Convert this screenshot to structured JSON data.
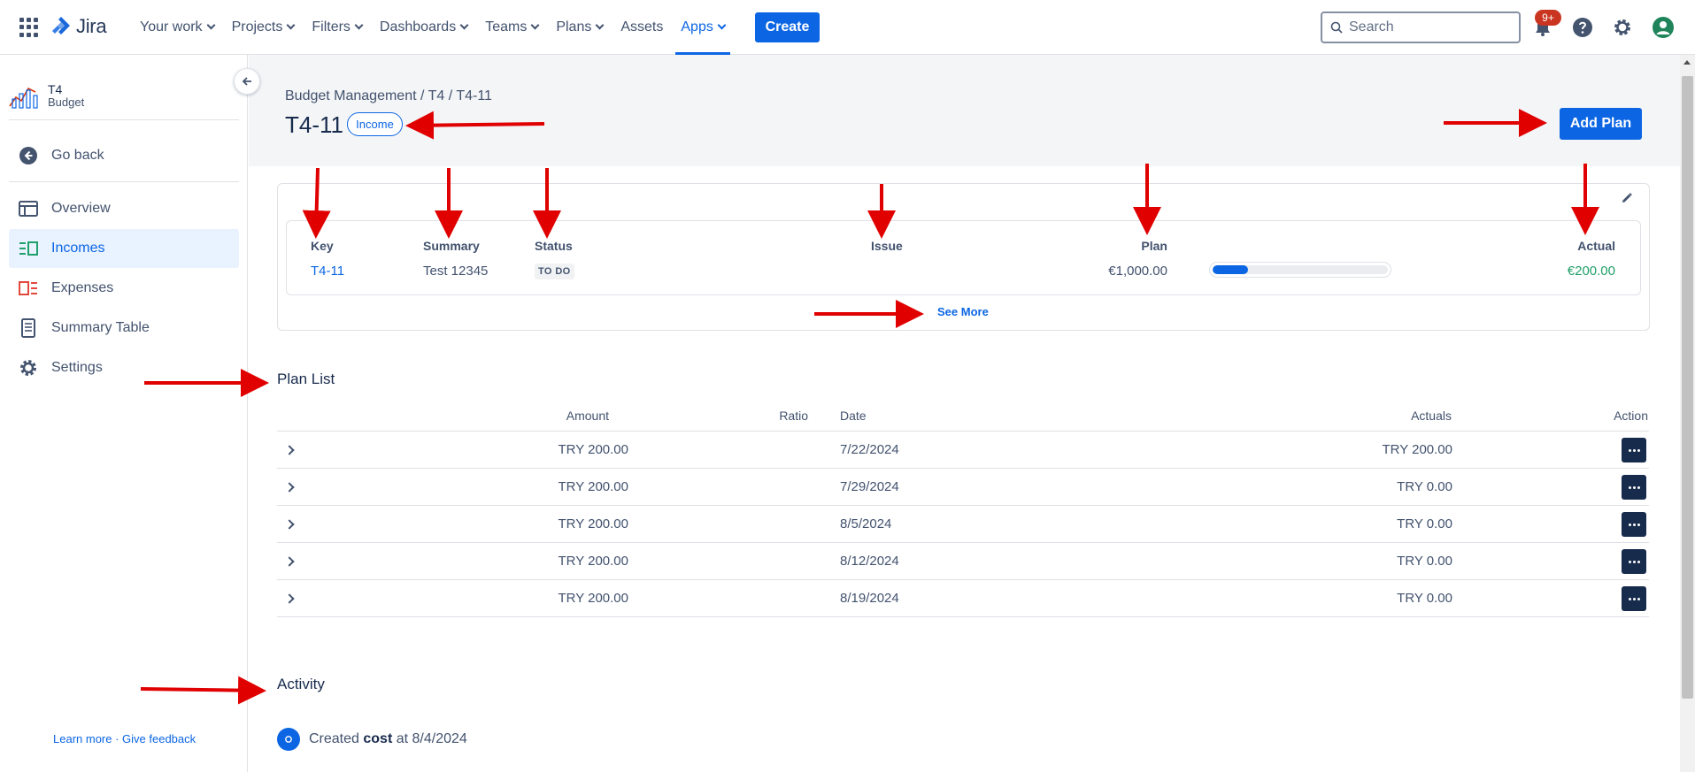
{
  "topnav": {
    "product": "Jira",
    "items": [
      {
        "label": "Your work",
        "dropdown": true
      },
      {
        "label": "Projects",
        "dropdown": true
      },
      {
        "label": "Filters",
        "dropdown": true
      },
      {
        "label": "Dashboards",
        "dropdown": true
      },
      {
        "label": "Teams",
        "dropdown": true
      },
      {
        "label": "Plans",
        "dropdown": true
      },
      {
        "label": "Assets",
        "dropdown": false
      },
      {
        "label": "Apps",
        "dropdown": true,
        "active": true
      }
    ],
    "create_label": "Create",
    "search_placeholder": "Search",
    "notification_badge": "9+"
  },
  "sidebar": {
    "project_name": "T4",
    "project_sub": "Budget",
    "items": [
      {
        "label": "Go back",
        "icon": "arrow-left-circle-icon"
      },
      {
        "label": "Overview",
        "icon": "overview-icon"
      },
      {
        "label": "Incomes",
        "icon": "incomes-icon",
        "active": true
      },
      {
        "label": "Expenses",
        "icon": "expenses-icon"
      },
      {
        "label": "Summary Table",
        "icon": "summary-table-icon"
      },
      {
        "label": "Settings",
        "icon": "gear-icon"
      }
    ],
    "footer": "Learn more · Give feedback"
  },
  "header": {
    "breadcrumb": "Budget Management  / T4  / T4-11",
    "title": "T4-11",
    "type_lozenge": "Income",
    "add_plan_label": "Add Plan"
  },
  "summary": {
    "headers": {
      "key": "Key",
      "summary": "Summary",
      "status": "Status",
      "issue": "Issue",
      "plan": "Plan",
      "actual": "Actual"
    },
    "row": {
      "key": "T4-11",
      "summary": "Test 12345",
      "status": "TO DO",
      "issue": "",
      "plan": "€1,000.00",
      "progress": 0.2,
      "actual": "€200.00"
    },
    "see_more": "See More"
  },
  "plan_list": {
    "title": "Plan List",
    "headers": {
      "amount": "Amount",
      "ratio": "Ratio",
      "date": "Date",
      "actuals": "Actuals",
      "action": "Action"
    },
    "rows": [
      {
        "amount": "TRY 200.00",
        "ratio": "",
        "date": "7/22/2024",
        "actual": "TRY 200.00"
      },
      {
        "amount": "TRY 200.00",
        "ratio": "",
        "date": "7/29/2024",
        "actual": "TRY 0.00"
      },
      {
        "amount": "TRY 200.00",
        "ratio": "",
        "date": "8/5/2024",
        "actual": "TRY 0.00"
      },
      {
        "amount": "TRY 200.00",
        "ratio": "",
        "date": "8/12/2024",
        "actual": "TRY 0.00"
      },
      {
        "amount": "TRY 200.00",
        "ratio": "",
        "date": "8/19/2024",
        "actual": "TRY 0.00"
      }
    ]
  },
  "activity": {
    "title": "Activity",
    "entry_prefix": "Created",
    "entry_bold": "cost",
    "entry_suffix": "at 8/4/2024"
  },
  "colors": {
    "brand": "#0c66e4",
    "actual_green": "#22a06b",
    "annotation_red": "#e00000"
  }
}
